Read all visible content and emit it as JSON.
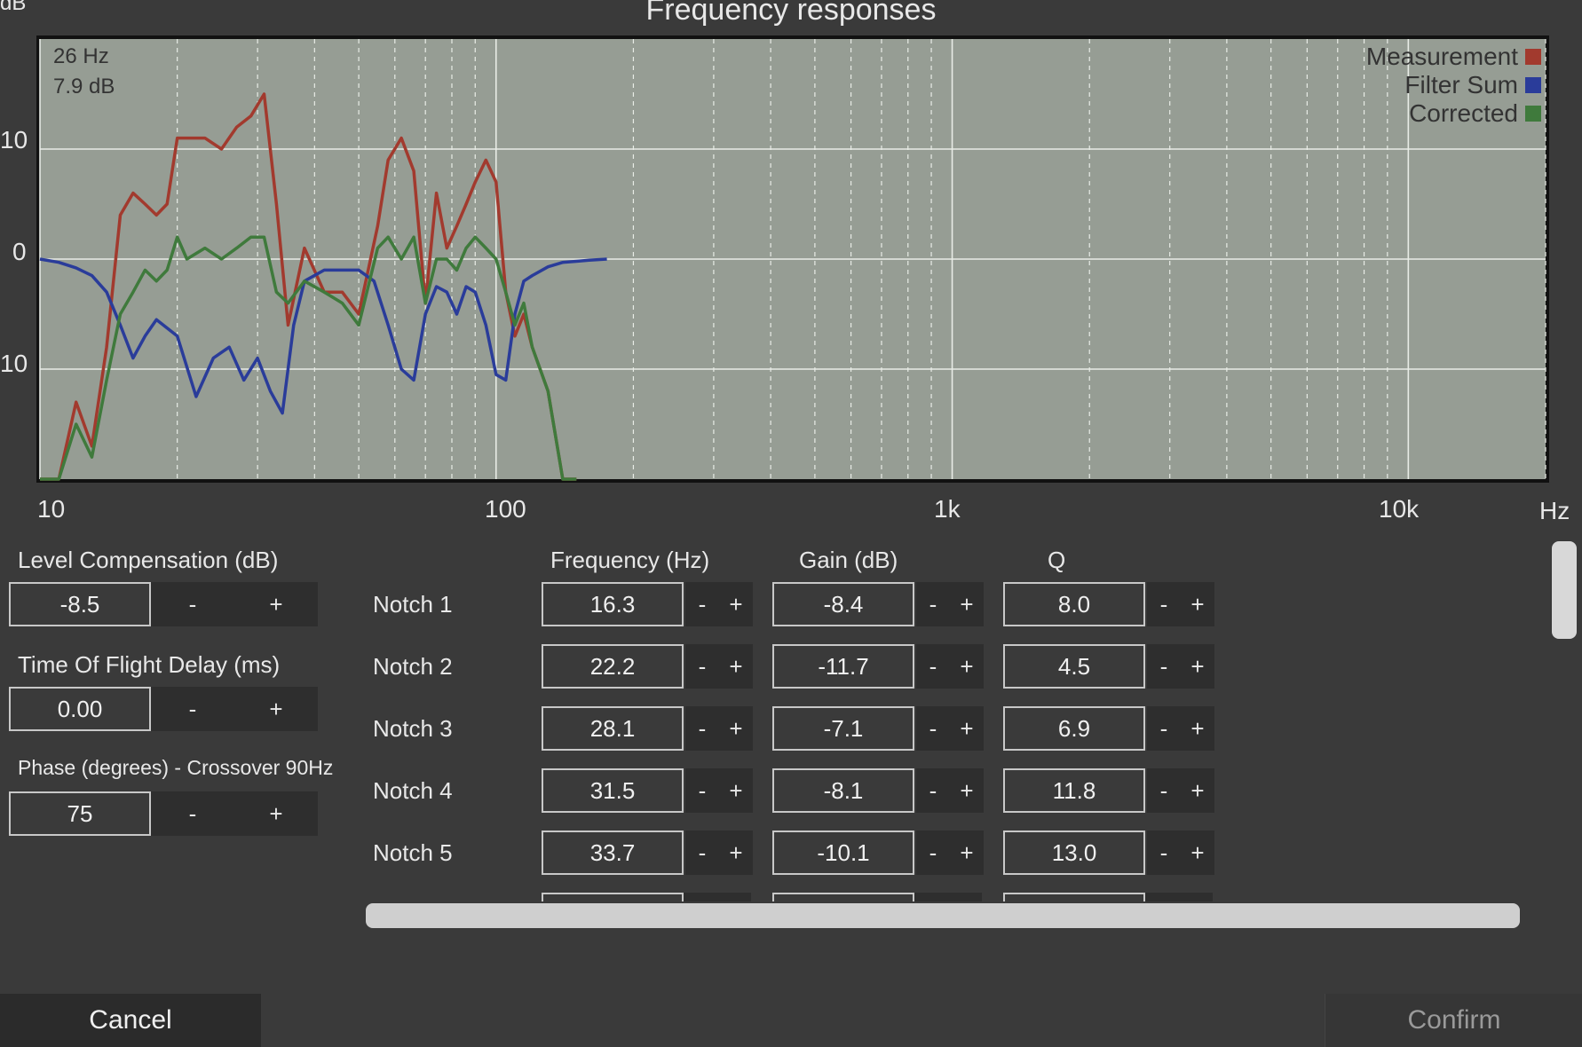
{
  "chart": {
    "title": "Frequency responses",
    "y_unit": "dB",
    "x_unit": "Hz",
    "y_tick_labels": [
      "10",
      "0",
      "10"
    ],
    "x_tick_labels": [
      "10",
      "100",
      "1k",
      "10k"
    ],
    "readout": {
      "frequency": "26 Hz",
      "level": "7.9 dB"
    },
    "legend": [
      {
        "label": "Measurement",
        "color": "#a23a2e"
      },
      {
        "label": "Filter Sum",
        "color": "#2a3c9a"
      },
      {
        "label": "Corrected",
        "color": "#3f7a3c"
      }
    ]
  },
  "chart_data": {
    "type": "line",
    "title": "Frequency responses",
    "xlabel": "Hz",
    "ylabel": "dB",
    "x_scale": "log",
    "xlim": [
      10,
      20000
    ],
    "ylim": [
      -20,
      20
    ],
    "grid": true,
    "legend_position": "top-right",
    "series": [
      {
        "name": "Measurement",
        "x": [
          10,
          11,
          12,
          13,
          14,
          15,
          16,
          17,
          18,
          19,
          20,
          21,
          23,
          25,
          27,
          29,
          31,
          33,
          35,
          38,
          42,
          46,
          50,
          55,
          58,
          62,
          66,
          70,
          74,
          78,
          82,
          86,
          90,
          95,
          100,
          105,
          110,
          115,
          120,
          130,
          140,
          150
        ],
        "y": [
          -22,
          -21,
          -13,
          -17,
          -8,
          4,
          6,
          5,
          4,
          5,
          11,
          11,
          11,
          10,
          12,
          13,
          15,
          5,
          -6,
          1,
          -3,
          -3,
          -5,
          3,
          9,
          11,
          8,
          -4,
          6,
          1,
          3,
          5,
          7,
          9,
          7,
          -3,
          -7,
          -5,
          -8,
          -12,
          -22,
          -22
        ]
      },
      {
        "name": "Filter Sum",
        "x": [
          10,
          11,
          12,
          13,
          14,
          15,
          16,
          17,
          18,
          20,
          22,
          24,
          26,
          28,
          30,
          32,
          34,
          36,
          38,
          42,
          46,
          50,
          54,
          58,
          62,
          66,
          70,
          74,
          78,
          82,
          86,
          90,
          95,
          100,
          105,
          110,
          115,
          120,
          130,
          140,
          150,
          160,
          175
        ],
        "y": [
          0,
          -0.3,
          -0.8,
          -1.5,
          -3,
          -6,
          -9,
          -7,
          -5.5,
          -7,
          -12.5,
          -9,
          -8,
          -11,
          -9,
          -12,
          -14,
          -6,
          -2,
          -1,
          -1,
          -1,
          -2,
          -6,
          -10,
          -11,
          -5,
          -2.5,
          -3,
          -5,
          -2.5,
          -3,
          -6,
          -10.5,
          -11,
          -5,
          -2,
          -1.5,
          -0.7,
          -0.3,
          -0.2,
          -0.1,
          0
        ]
      },
      {
        "name": "Corrected",
        "x": [
          10,
          11,
          12,
          13,
          14,
          15,
          16,
          17,
          18,
          19,
          20,
          21,
          23,
          25,
          27,
          29,
          31,
          33,
          35,
          38,
          42,
          46,
          50,
          55,
          58,
          62,
          66,
          70,
          74,
          78,
          82,
          86,
          90,
          95,
          100,
          105,
          110,
          115,
          120,
          130,
          140,
          150
        ],
        "y": [
          -22,
          -21,
          -15,
          -18,
          -11,
          -5,
          -3,
          -1,
          -2,
          -1,
          2,
          0,
          1,
          0,
          1,
          2,
          2,
          -3,
          -4,
          -2,
          -3,
          -4,
          -6,
          1,
          2,
          0,
          2,
          -4,
          0,
          0,
          -1,
          1,
          2,
          1,
          0,
          -3,
          -6,
          -4,
          -8,
          -12,
          -22,
          -22
        ]
      }
    ]
  },
  "left_panel": {
    "level": {
      "label": "Level Compensation (dB)",
      "value": "-8.5",
      "minus": "-",
      "plus": "+"
    },
    "delay": {
      "label": "Time Of Flight Delay (ms)",
      "value": "0.00",
      "minus": "-",
      "plus": "+"
    },
    "phase": {
      "label": "Phase (degrees) - Crossover 90Hz",
      "value": "75",
      "minus": "-",
      "plus": "+"
    }
  },
  "notch_table": {
    "headers": {
      "frequency": "Frequency (Hz)",
      "gain": "Gain (dB)",
      "q": "Q"
    },
    "minus": "-",
    "plus": "+",
    "rows": [
      {
        "label": "Notch 1",
        "frequency": "16.3",
        "gain": "-8.4",
        "q": "8.0"
      },
      {
        "label": "Notch 2",
        "frequency": "22.2",
        "gain": "-11.7",
        "q": "4.5"
      },
      {
        "label": "Notch 3",
        "frequency": "28.1",
        "gain": "-7.1",
        "q": "6.9"
      },
      {
        "label": "Notch 4",
        "frequency": "31.5",
        "gain": "-8.1",
        "q": "11.8"
      },
      {
        "label": "Notch 5",
        "frequency": "33.7",
        "gain": "-10.1",
        "q": "13.0"
      }
    ]
  },
  "footer": {
    "cancel": "Cancel",
    "confirm": "Confirm"
  }
}
